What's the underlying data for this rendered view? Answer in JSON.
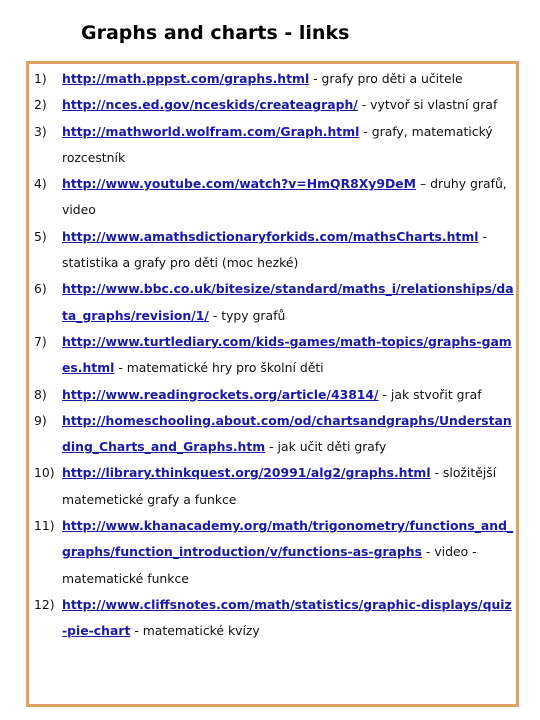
{
  "document": {
    "title": "Graphs and charts - links",
    "colors": {
      "border": "#e0a165",
      "link": "#1a1aa8",
      "text": "#111111"
    },
    "items": [
      {
        "num": "1)",
        "url": "http://math.pppst.com/graphs.html",
        "desc": " - grafy pro děti a učitele"
      },
      {
        "num": "2)",
        "url": "http://nces.ed.gov/nceskids/createagraph/",
        "desc": " - vytvoř si vlastní graf"
      },
      {
        "num": "3)",
        "url": "http://mathworld.wolfram.com/Graph.html",
        "desc": " - grafy, matematický rozcestník"
      },
      {
        "num": "4)",
        "url": "http://www.youtube.com/watch?v=HmQR8Xy9DeM",
        "desc": " – druhy grafů, video"
      },
      {
        "num": "5)",
        "url": "http://www.amathsdictionaryforkids.com/mathsCharts.html",
        "desc": " - statistika a grafy pro děti (moc hezké)"
      },
      {
        "num": "6)",
        "url": "http://www.bbc.co.uk/bitesize/standard/maths_i/relationships/data_graphs/revision/1/",
        "desc": " - typy grafů"
      },
      {
        "num": "7)",
        "url": "http://www.turtlediary.com/kids-games/math-topics/graphs-games.html",
        "desc": " - matematické hry pro školní děti"
      },
      {
        "num": "8)",
        "url": "http://www.readingrockets.org/article/43814/",
        "desc": " - jak stvořit graf"
      },
      {
        "num": "9)",
        "url": "http://homeschooling.about.com/od/chartsandgraphs/Understanding_Charts_and_Graphs.htm",
        "desc": " - jak učit děti grafy"
      },
      {
        "num": "10)",
        "url": "http://library.thinkquest.org/20991/alg2/graphs.html",
        "desc": " - složitější matemetické grafy a funkce"
      },
      {
        "num": "11)",
        "url": "http://www.khanacademy.org/math/trigonometry/functions_and_graphs/function_introduction/v/functions-as-graphs",
        "desc": " - video - matematické funkce"
      },
      {
        "num": "12)",
        "url": "http://www.cliffsnotes.com/math/statistics/graphic-displays/quiz-pie-chart",
        "desc": " - matematické kvízy"
      }
    ]
  }
}
